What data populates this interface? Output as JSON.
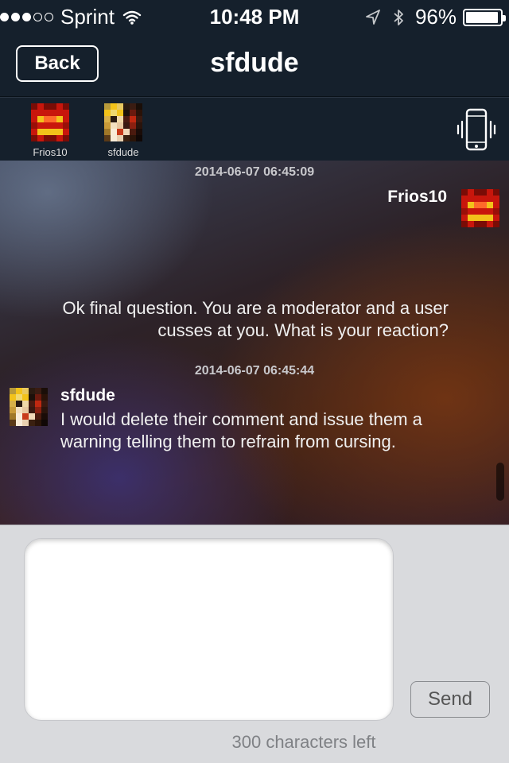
{
  "status_bar": {
    "signal_bars_filled": 3,
    "signal_bars_total": 5,
    "carrier": "Sprint",
    "time": "10:48 PM",
    "battery": "96%",
    "battery_level": 0.96,
    "icons": [
      "wifi-icon",
      "location-arrow-icon",
      "bluetooth-icon",
      "battery-icon"
    ]
  },
  "nav": {
    "back_label": "Back",
    "title": "sfdude"
  },
  "participants": [
    {
      "name": "Frios10",
      "avatar": "red-pixel-avatar"
    },
    {
      "name": "sfdude",
      "avatar": "blonde-pixel-avatar"
    }
  ],
  "vibrate_icon": "phone-vibrate-icon",
  "messages": [
    {
      "timestamp": "2014-06-07 06:45:09",
      "sender": "Frios10",
      "side": "right",
      "text_line1": "Ok final question. You are a moderator and a user",
      "text_line2": "cusses at you. What is your reaction?"
    },
    {
      "timestamp": "2014-06-07 06:45:44",
      "sender": "sfdude",
      "side": "left",
      "text_line1": "I would delete their comment and issue them a",
      "text_line2": "warning telling them to refrain from cursing."
    }
  ],
  "composer": {
    "input_value": "",
    "send_label": "Send",
    "chars_left": "300 characters left"
  },
  "colors": {
    "header_bg": "#15202c",
    "composer_bg": "#d9dadd",
    "avatar_red": "#c8160c",
    "avatar_yellow": "#f2c21a"
  }
}
